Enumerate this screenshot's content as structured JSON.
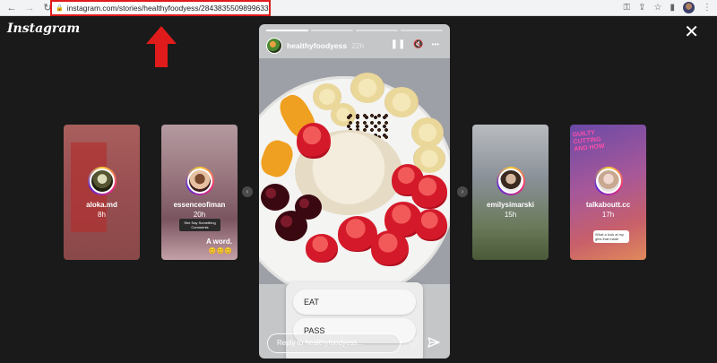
{
  "browser": {
    "url": "instagram.com/stories/healthyfoodyess/2843835509899633310/",
    "nav_back_icon": "←",
    "nav_forward_icon": "→",
    "reload_icon": "↻",
    "lock_icon": "🔒",
    "key_icon": "⚿",
    "share_icon": "⇪",
    "star_icon": "☆",
    "sidebar_icon": "▮",
    "menu_icon": "⋮"
  },
  "annotation": {
    "arrow_color": "#e01b1b"
  },
  "app": {
    "logo": "Instagram",
    "close_icon": "✕"
  },
  "side_stories": [
    {
      "username": "aloka.md",
      "time": "8h"
    },
    {
      "username": "essenceofiman",
      "time": "20h",
      "tag": "She Say Something Comments",
      "caption": "A word.",
      "emoji": "😊😊😊"
    },
    {
      "username": "emilysimarski",
      "time": "15h"
    },
    {
      "username": "talkaboutt.cc",
      "time": "17h",
      "poster": "GUILTY CUTTING AND HOW",
      "sub_card": "What a look at my girls that made"
    }
  ],
  "nav_arrows": {
    "prev": "‹",
    "next": "›"
  },
  "story": {
    "username": "healthyfoodyess",
    "time": "22h",
    "progress": {
      "segments": 4,
      "completed": 1
    },
    "pause_icon": "❚❚",
    "mute_icon": "🔇",
    "more_icon": "•••",
    "poll": {
      "option_a": "EAT",
      "option_b": "PASS"
    },
    "reply_placeholder": "Reply to healthyfoodyess...",
    "heart_icon": "♡"
  }
}
